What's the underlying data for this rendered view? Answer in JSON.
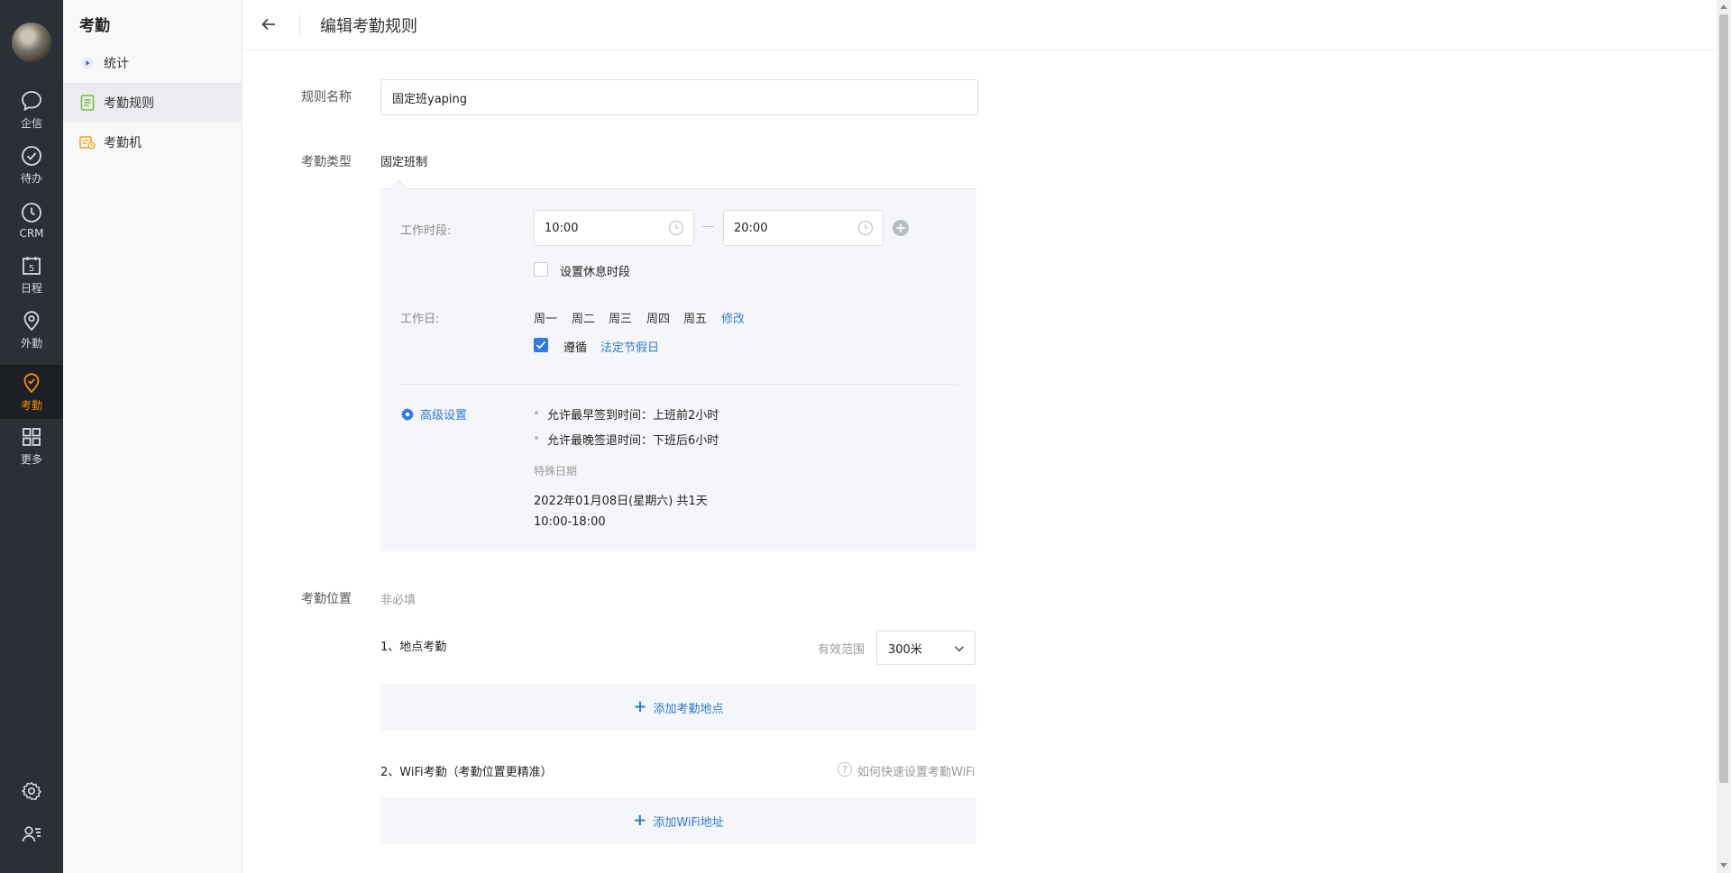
{
  "rail": {
    "items": [
      {
        "label": "企信",
        "icon": "chat-bubble-icon"
      },
      {
        "label": "待办",
        "icon": "check-circle-icon"
      },
      {
        "label": "CRM",
        "icon": "clock-icon"
      },
      {
        "label": "日程",
        "icon": "calendar-icon",
        "badge": "5"
      },
      {
        "label": "外勤",
        "icon": "location-pin-icon"
      },
      {
        "label": "考勤",
        "icon": "attendance-icon",
        "active": true
      },
      {
        "label": "更多",
        "icon": "grid-icon"
      }
    ],
    "bottom": [
      "gear-icon",
      "user-list-icon"
    ]
  },
  "sidebar": {
    "title": "考勤",
    "items": [
      {
        "label": "统计",
        "icon": "play-dot-icon"
      },
      {
        "label": "考勤规则",
        "icon": "document-icon",
        "active": true
      },
      {
        "label": "考勤机",
        "icon": "machine-icon"
      }
    ]
  },
  "header": {
    "title": "编辑考勤规则"
  },
  "form": {
    "rule_name": {
      "label": "规则名称",
      "value": "固定班yaping"
    },
    "type": {
      "label": "考勤类型",
      "value": "固定班制"
    },
    "work_time": {
      "label": "工作时段:",
      "start": "10:00",
      "end": "20:00",
      "dash": "—"
    },
    "rest": {
      "label": "设置休息时段",
      "checked": false
    },
    "work_days": {
      "label": "工作日:",
      "days": [
        "周一",
        "周二",
        "周三",
        "周四",
        "周五"
      ],
      "edit": "修改"
    },
    "holiday": {
      "checked": true,
      "prefix": "遵循",
      "link": "法定节假日"
    },
    "advanced": {
      "label": "高级设置",
      "rules": [
        "允许最早签到时间：上班前2小时",
        "允许最晚签退时间：下班后6小时"
      ],
      "special_label": "特殊日期",
      "special_date": "2022年01月08日(星期六) 共1天",
      "special_time": "10:00-18:00"
    },
    "location": {
      "label": "考勤位置",
      "optional": "非必填",
      "place_title": "1、地点考勤",
      "range_label": "有效范围",
      "range_value": "300米",
      "add_place": "添加考勤地点",
      "wifi_title": "2、WiFi考勤（考勤位置更精准）",
      "wifi_help": "如何快速设置考勤WiFi",
      "add_wifi": "添加WiFi地址"
    }
  },
  "colors": {
    "accent": "#2f7be0",
    "active_nav": "#ff8a00",
    "rail_bg": "#2b2f36"
  }
}
